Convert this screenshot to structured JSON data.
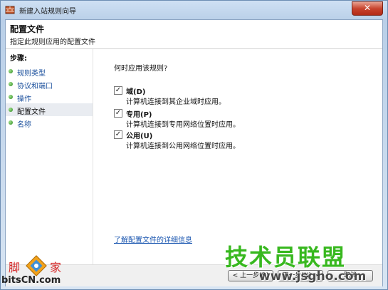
{
  "window": {
    "title": "新建入站规则向导",
    "close_glyph": "✕"
  },
  "header": {
    "title": "配置文件",
    "subtitle": "指定此规则应用的配置文件"
  },
  "steps": {
    "heading": "步骤:",
    "items": [
      {
        "label": "规则类型",
        "active": false
      },
      {
        "label": "协议和端口",
        "active": false
      },
      {
        "label": "操作",
        "active": false
      },
      {
        "label": "配置文件",
        "active": true
      },
      {
        "label": "名称",
        "active": false
      }
    ]
  },
  "main": {
    "question": "何时应用该规则?",
    "options": [
      {
        "label": "域(D)",
        "description": "计算机连接到其企业域时应用。",
        "checked": true
      },
      {
        "label": "专用(P)",
        "description": "计算机连接到专用网络位置时应用。",
        "checked": true
      },
      {
        "label": "公用(U)",
        "description": "计算机连接到公用网络位置时应用。",
        "checked": true
      }
    ],
    "link": "了解配置文件的详细信息"
  },
  "buttons": {
    "back": "< 上一步(B)",
    "next": "下一步(N) >",
    "cancel": "取消"
  },
  "watermarks": {
    "right_title": "技术员联盟",
    "right_url": "www.jsgho.com",
    "left_char1": "脚",
    "left_char2": "家",
    "left_site": "bitsCN.com"
  },
  "colors": {
    "accent_link": "#1a56b0",
    "step_dot": "#2d8a1e",
    "watermark_green": "#38b81f"
  },
  "icons": {
    "title": "firewall-icon",
    "checkbox": "check-icon",
    "step": "green-dot-icon"
  }
}
